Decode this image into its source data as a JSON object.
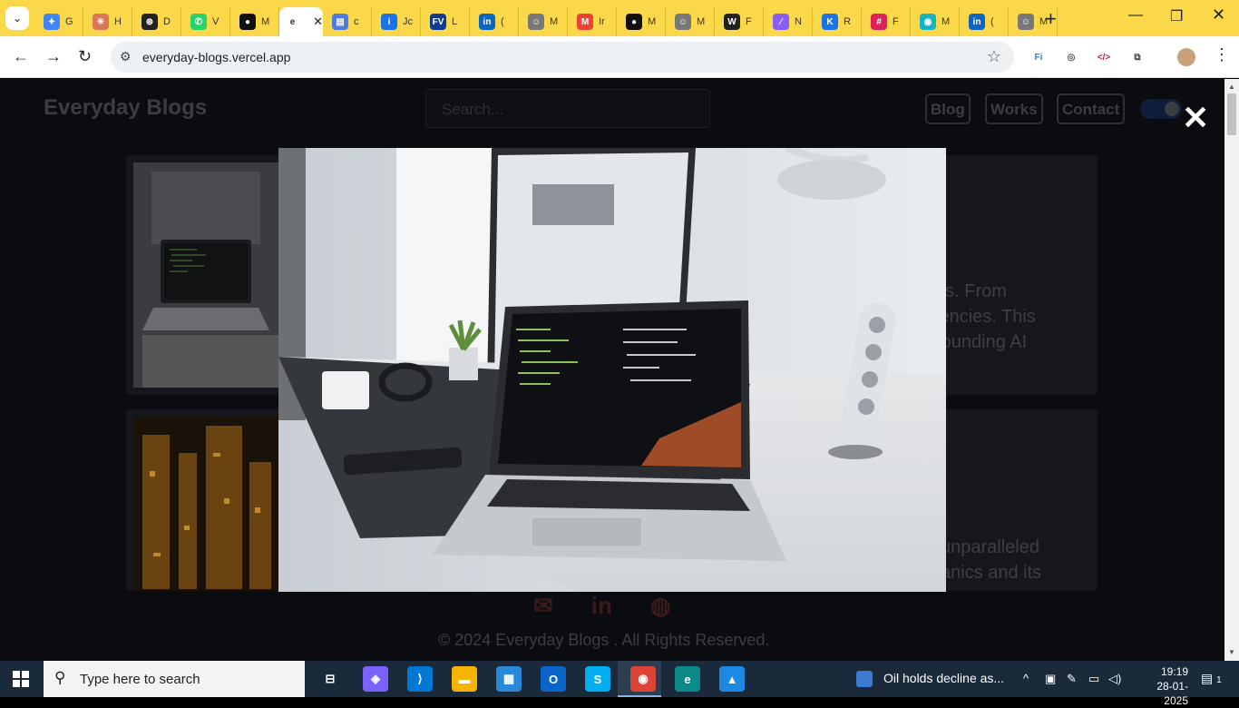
{
  "browser": {
    "url": "everyday-blogs.vercel.app",
    "tabs": [
      {
        "icon": "gemini-icon",
        "letter": "G",
        "color": "#4285f4",
        "glyph": "✦"
      },
      {
        "icon": "claude-icon",
        "letter": "H",
        "color": "#d97757",
        "glyph": "✳"
      },
      {
        "icon": "chatgpt-icon",
        "letter": "D",
        "color": "#222222",
        "glyph": "⊛"
      },
      {
        "icon": "whatsapp-icon",
        "letter": "V",
        "color": "#25d366",
        "glyph": "✆"
      },
      {
        "icon": "github-icon",
        "letter": "M",
        "color": "#111111",
        "glyph": "●"
      },
      {
        "icon": "active-site-icon",
        "letter": "e",
        "color": "#ffffff",
        "glyph": "e",
        "active": true
      },
      {
        "icon": "docs-icon",
        "letter": "c",
        "color": "#4a7be0",
        "glyph": "▤"
      },
      {
        "icon": "info-icon",
        "letter": "Jc",
        "color": "#1a73e8",
        "glyph": "i"
      },
      {
        "icon": "fv-icon",
        "letter": "L",
        "color": "#0b3d91",
        "glyph": "FV"
      },
      {
        "icon": "linkedin-icon",
        "letter": "(",
        "color": "#0a66c2",
        "glyph": "in"
      },
      {
        "icon": "profile-icon",
        "letter": "M",
        "color": "#777777",
        "glyph": "☺"
      },
      {
        "icon": "gmail-icon",
        "letter": "Ir",
        "color": "#ea4335",
        "glyph": "M"
      },
      {
        "icon": "github-icon",
        "letter": "M",
        "color": "#111111",
        "glyph": "●"
      },
      {
        "icon": "profile-icon",
        "letter": "M",
        "color": "#777777",
        "glyph": "☺"
      },
      {
        "icon": "webflow-icon",
        "letter": "F",
        "color": "#222222",
        "glyph": "W"
      },
      {
        "icon": "gradient-icon",
        "letter": "N",
        "color": "#8a5cf6",
        "glyph": "⁄"
      },
      {
        "icon": "k-icon",
        "letter": "R",
        "color": "#1a73e8",
        "glyph": "K"
      },
      {
        "icon": "slack-icon",
        "letter": "F",
        "color": "#e01e5a",
        "glyph": "#"
      },
      {
        "icon": "circle-icon",
        "letter": "M",
        "color": "#17b3c2",
        "glyph": "◉"
      },
      {
        "icon": "linkedin-icon",
        "letter": "(",
        "color": "#0a66c2",
        "glyph": "in"
      },
      {
        "icon": "profile-icon",
        "letter": "M",
        "color": "#777777",
        "glyph": "☺"
      }
    ],
    "extensions": [
      {
        "icon": "fi-extension-icon",
        "glyph": "Fi",
        "color": "#2b7de9"
      },
      {
        "icon": "lens-extension-icon",
        "glyph": "◎",
        "color": "#555555"
      },
      {
        "icon": "code-extension-icon",
        "glyph": "</>",
        "color": "#c2185b"
      },
      {
        "icon": "puzzle-extension-icon",
        "glyph": "⧉",
        "color": "#444444"
      }
    ]
  },
  "site": {
    "title": "Everyday Blogs",
    "search_placeholder": "Search...",
    "nav": [
      "Blog",
      "Works",
      "Contact"
    ],
    "cards": [
      {
        "excerpt_lines": [
          "es. From",
          "iencies. This",
          "rounding AI"
        ]
      },
      {
        "excerpt_lines": [
          "unparalleled",
          "anics and its"
        ]
      }
    ],
    "footer_icons": [
      "envelope-icon",
      "linkedin-icon",
      "github-icon"
    ],
    "footer_glyphs": [
      "✉",
      "in",
      "◍"
    ],
    "copyright": "© 2024 Everyday Blogs . All Rights Reserved."
  },
  "lightbox": {
    "close_glyph": "✕"
  },
  "taskbar": {
    "search_placeholder": "Type here to search",
    "news": "Oil holds decline as...",
    "time": "19:19",
    "date": "28-01-2025",
    "notifications": "1",
    "apps": [
      {
        "name": "task-view-icon",
        "glyph": "⊟",
        "color": "#1b2a3a"
      },
      {
        "name": "copilot-icon",
        "glyph": "◈",
        "color": "#7b61ff"
      },
      {
        "name": "vscode-icon",
        "glyph": "⟩",
        "color": "#0078d4"
      },
      {
        "name": "file-explorer-icon",
        "glyph": "▬",
        "color": "#f4b400"
      },
      {
        "name": "store-icon",
        "glyph": "▦",
        "color": "#2b88d8"
      },
      {
        "name": "outlook-icon",
        "glyph": "O",
        "color": "#0a64c9"
      },
      {
        "name": "skype-icon",
        "glyph": "S",
        "color": "#00aff0"
      },
      {
        "name": "chrome-icon",
        "glyph": "◉",
        "color": "#db4437"
      },
      {
        "name": "edge-icon",
        "glyph": "e",
        "color": "#0c8a8a"
      },
      {
        "name": "photos-icon",
        "glyph": "▲",
        "color": "#1e88e5"
      }
    ]
  }
}
